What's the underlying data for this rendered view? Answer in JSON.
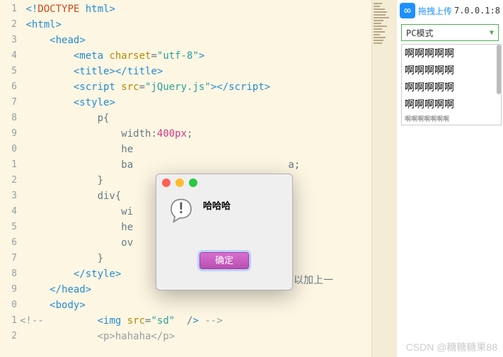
{
  "code": {
    "l1": {
      "doctype_punct": "<!",
      "doctype_kw": "DOCTYPE",
      "doctype_val": " html",
      "close": ">"
    },
    "l2": {
      "open": "<",
      "tag": "html",
      "close": ">"
    },
    "l3": {
      "open": "<",
      "tag": "head",
      "close": ">"
    },
    "l4": {
      "open": "<",
      "tag": "meta",
      "attr": " charset",
      "eq": "=",
      "val": "\"utf-8\"",
      "close": ">"
    },
    "l5": {
      "t1": "<title>",
      "t2": "</title>"
    },
    "l6": {
      "open": "<",
      "tag": "script",
      "attr": " src",
      "eq": "=",
      "val": "\"jQuery.js\"",
      "mid": "></",
      "tag2": "script",
      "close": ">"
    },
    "l7": {
      "open": "<",
      "tag": "style",
      "close": ">"
    },
    "l8": "p{",
    "l9": {
      "prop": "width",
      "colon": ":",
      "val": "400px",
      "semi": ";"
    },
    "l10": "he",
    "l11": "ba",
    "l12": "}",
    "l13": "div{",
    "l14": "wi",
    "l15": "he",
    "l16": "ov",
    "l17": "}",
    "l18": {
      "open": "</",
      "tag": "style",
      "close": ">"
    },
    "l19": {
      "open": "</",
      "tag": "head",
      "close": ">"
    },
    "l20": {
      "open": "<",
      "tag": "body",
      "close": ">"
    },
    "l21": {
      "comment": "<!--",
      "open": "<",
      "tag": "img",
      "attr": " src",
      "eq": "=",
      "val": "\"sd\"",
      "slash": "  /",
      "close": ">",
      "comment_end": " -->"
    },
    "l22_comment": "<p>hahaha</p>"
  },
  "line_numbers": [
    "1",
    "2",
    "3",
    "4",
    "5",
    "6",
    "7",
    "8",
    "9",
    "0",
    "1",
    "2",
    "3",
    "4",
    "5",
    "6",
    "7",
    "8",
    "9",
    "0",
    "1",
    "2"
  ],
  "overflow_hint": "超出时设置可以加上一",
  "overflow_after_ba": "a;",
  "modal": {
    "message": "哈哈哈",
    "ok_label": "确定"
  },
  "right": {
    "upload_label": "拖拽上传",
    "ip": "7.0.0.1:8",
    "mode": "PC模式",
    "preview_lines": [
      "啊啊啊啊啊",
      "啊啊啊啊啊",
      "啊啊啊啊啊",
      "啊啊啊啊啊"
    ]
  },
  "watermark": "CSDN @糖糖糖果88"
}
